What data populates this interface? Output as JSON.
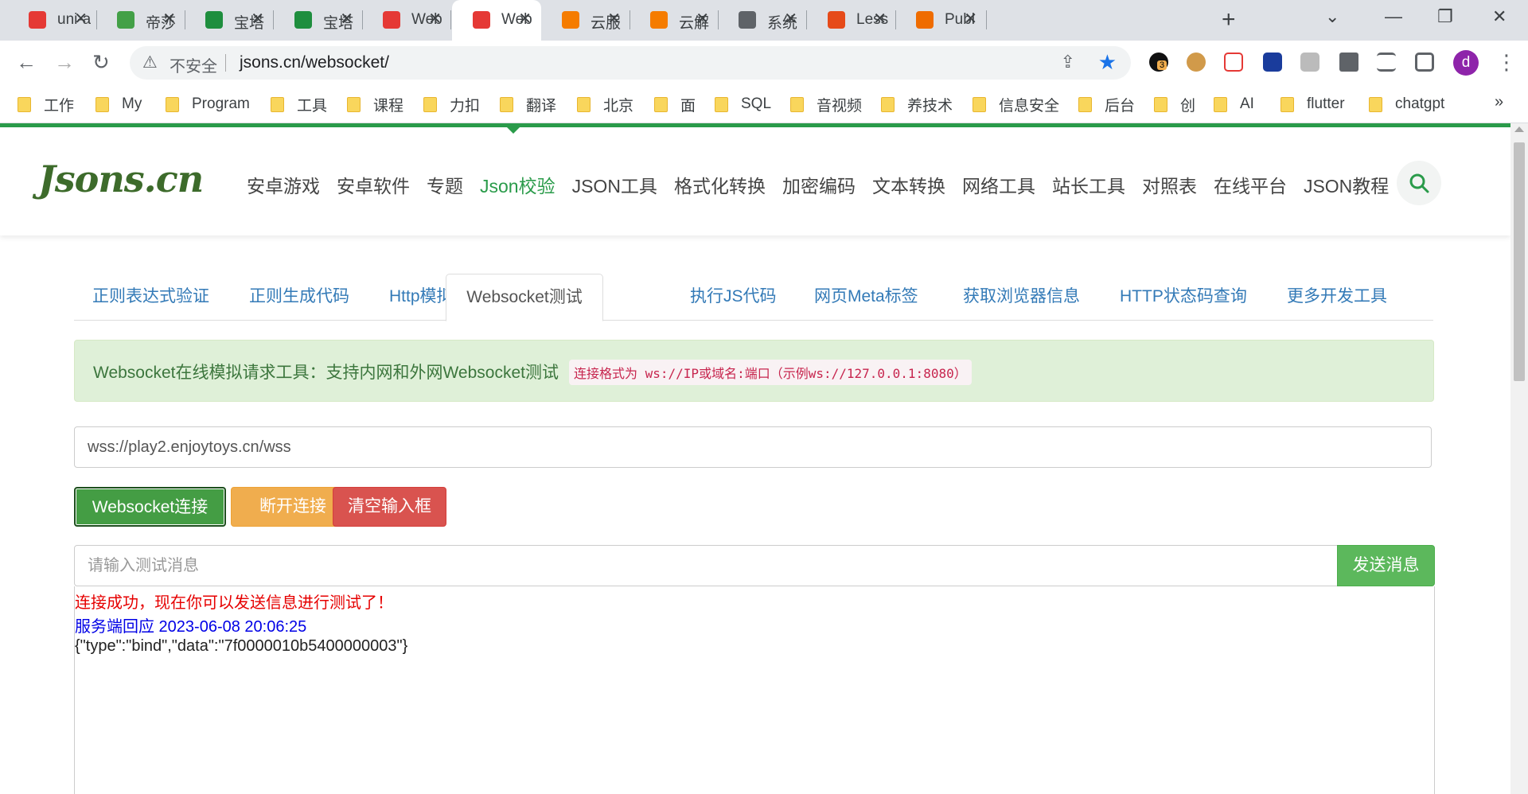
{
  "browser": {
    "tabs": [
      {
        "title": "uni-a",
        "color": "#e53935",
        "icon": "uni-app-icon"
      },
      {
        "title": "帝莎",
        "color": "#43a047",
        "icon": "leaf-icon"
      },
      {
        "title": "宝塔",
        "color": "#1e8e3e",
        "icon": "shield-icon"
      },
      {
        "title": "宝塔",
        "color": "#1e8e3e",
        "icon": "shield-icon"
      },
      {
        "title": "Web",
        "color": "#e53935",
        "icon": "checkmark-icon"
      },
      {
        "title": "Web",
        "color": "#e53935",
        "icon": "checkmark-icon",
        "active": true
      },
      {
        "title": "云服",
        "color": "#f57c00",
        "icon": "aliyun-icon"
      },
      {
        "title": "云解",
        "color": "#f57c00",
        "icon": "aliyun-icon"
      },
      {
        "title": "系统",
        "color": "#5f6368",
        "icon": "globe-icon"
      },
      {
        "title": "Less",
        "color": "#e64a19",
        "icon": "postman-icon"
      },
      {
        "title": "Publ",
        "color": "#ef6c00",
        "icon": "postman-icon"
      }
    ],
    "insecure_label": "不安全",
    "url": "jsons.cn/websocket/",
    "avatar_letter": "d",
    "ext_badge": "3",
    "bookmarks": [
      "工作",
      "My",
      "Program",
      "工具",
      "课程",
      "力扣",
      "翻译",
      "北京",
      "面",
      "SQL",
      "音视频",
      "养技术",
      "信息安全",
      "后台",
      "创",
      "AI",
      "flutter",
      "chatgpt"
    ]
  },
  "site": {
    "logo": "Jsons.cn",
    "nav": [
      "安卓游戏",
      "安卓软件",
      "专题",
      "Json校验",
      "JSON工具",
      "格式化转换",
      "加密编码",
      "文本转换",
      "网络工具",
      "站长工具",
      "对照表",
      "在线平台",
      "JSON教程"
    ],
    "nav_active": "Json校验",
    "accent": "#2a9b4a"
  },
  "tool_tabs": [
    "正则表达式验证",
    "正则生成代码",
    "Http模拟请求",
    "Websocket测试",
    "执行JS代码",
    "网页Meta标签",
    "获取浏览器信息",
    "HTTP状态码查询",
    "更多开发工具"
  ],
  "tool_tab_active": "Websocket测试",
  "alert": {
    "text": "Websocket在线模拟请求工具：支持内网和外网Websocket测试",
    "code": "连接格式为 ws://IP或域名:端口（示例ws://127.0.0.1:8080）"
  },
  "ws_url": "wss://play2.enjoytoys.cn/wss",
  "buttons": {
    "connect": "Websocket连接",
    "disconnect": "断开连接",
    "clear": "清空输入框",
    "send": "发送消息"
  },
  "message_placeholder": "请输入测试消息",
  "log": {
    "line1": "连接成功，现在你可以发送信息进行测试了！",
    "line2": "服务端回应 2023-06-08 20:06:25",
    "line3": "{\"type\":\"bind\",\"data\":\"7f0000010b5400000003\"}"
  }
}
